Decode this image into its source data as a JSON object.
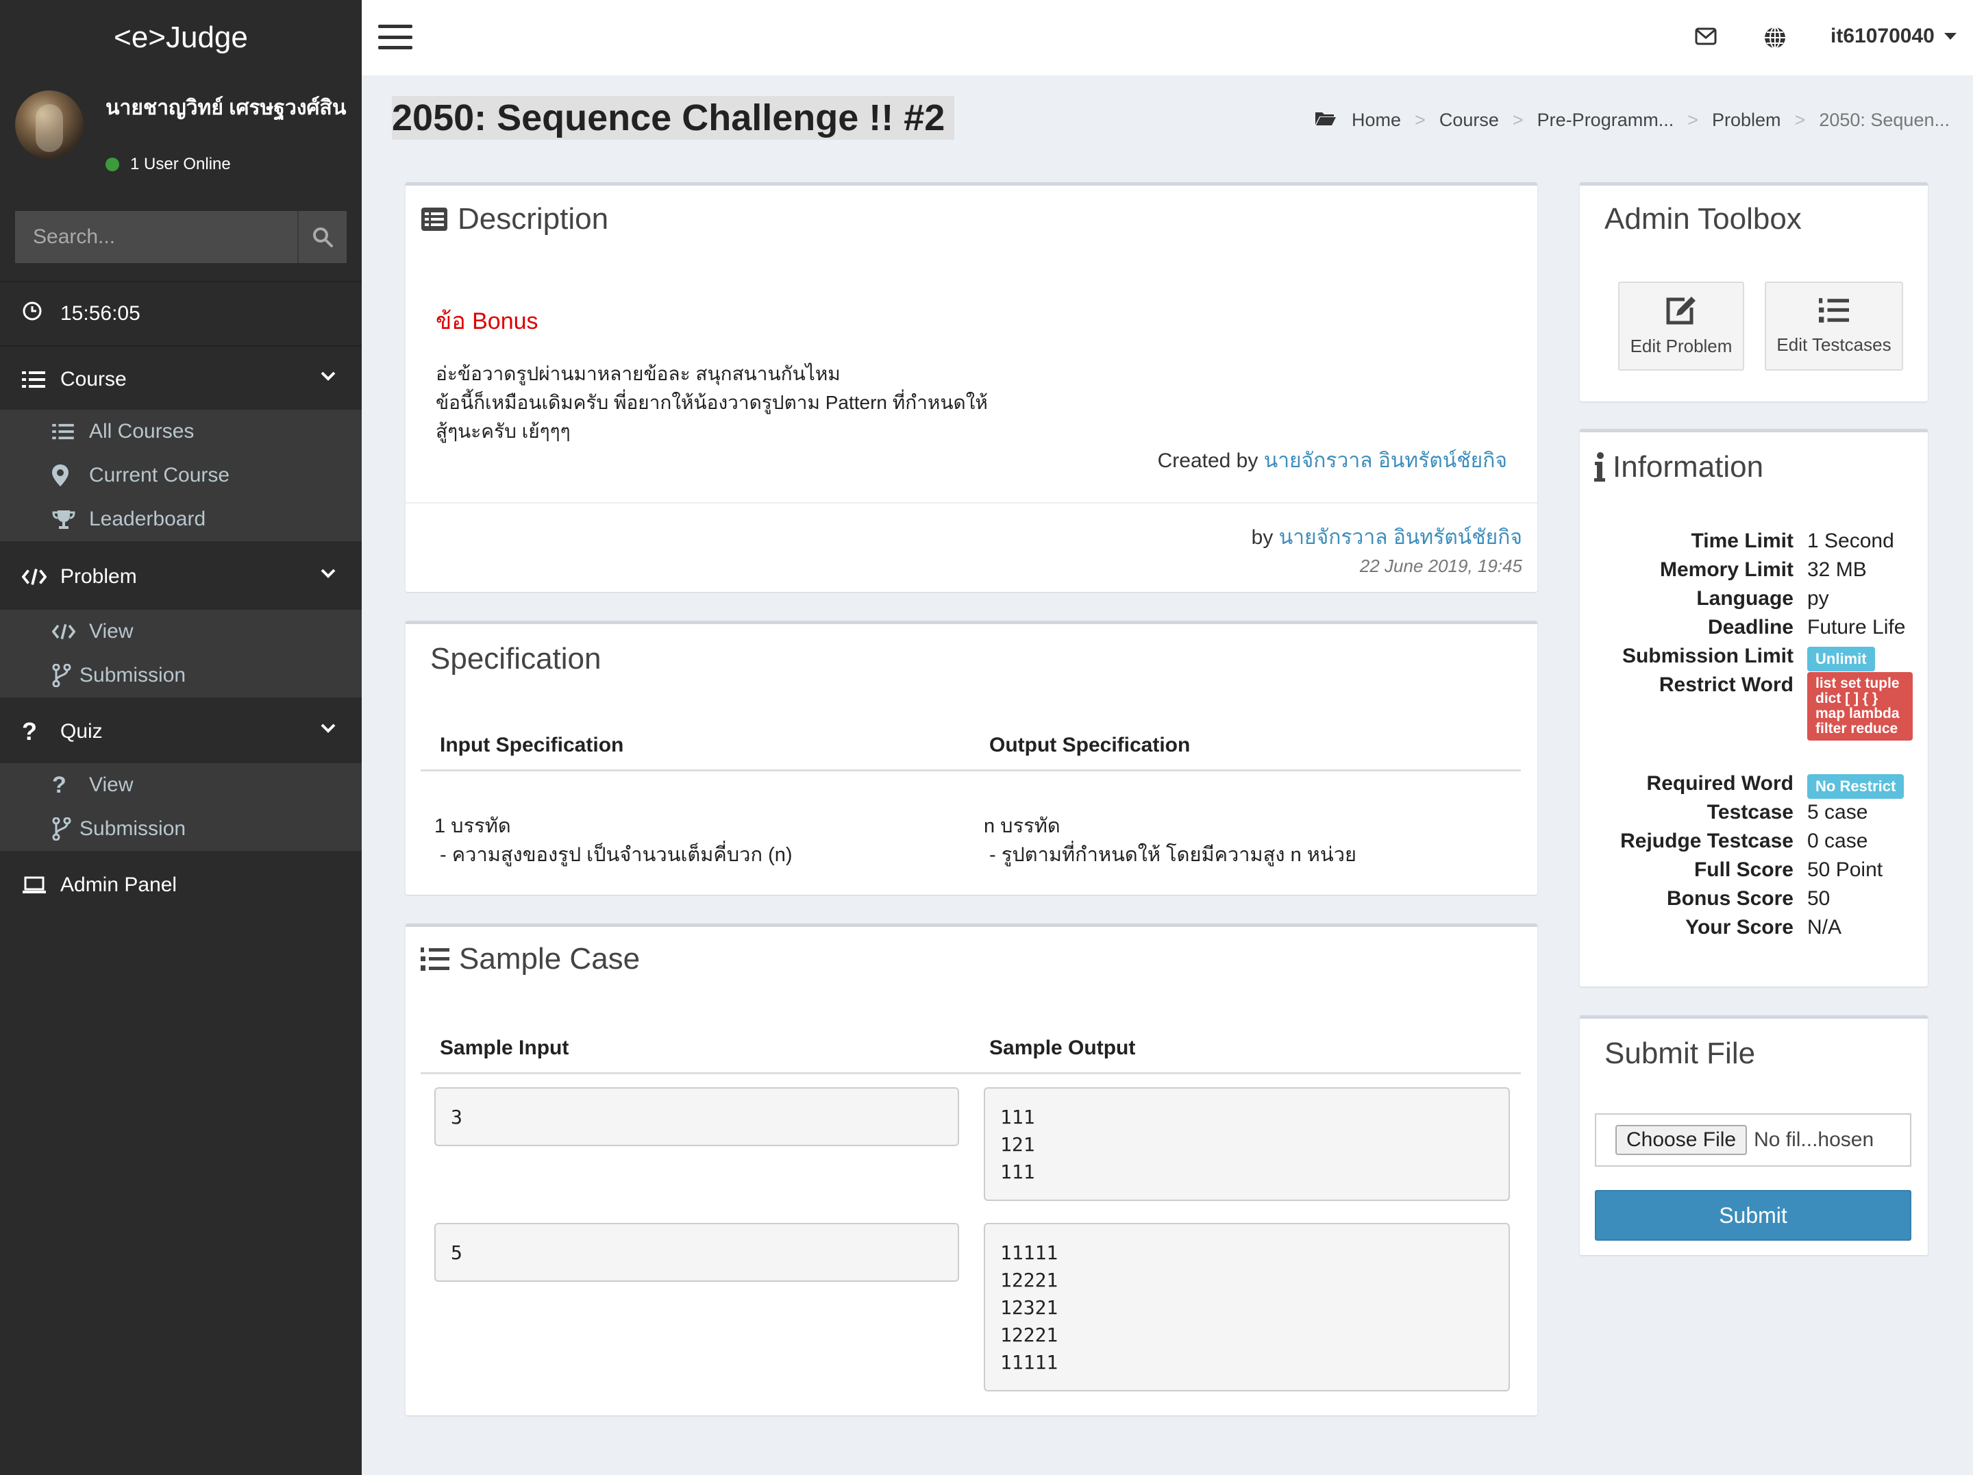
{
  "app": {
    "logo": "<e>Judge"
  },
  "user": {
    "name": "นายชาญวิทย์ เศรษฐวงศ์สิน",
    "status": "1 User Online"
  },
  "search": {
    "placeholder": "Search..."
  },
  "clock": {
    "time": "15:56:05"
  },
  "sidebar": {
    "course": {
      "label": "Course",
      "items": [
        "All Courses",
        "Current Course",
        "Leaderboard"
      ]
    },
    "problem": {
      "label": "Problem",
      "items": [
        "View",
        "Submission"
      ]
    },
    "quiz": {
      "label": "Quiz",
      "items": [
        "View",
        "Submission"
      ]
    },
    "admin": {
      "label": "Admin Panel"
    }
  },
  "topbar": {
    "username": "it61070040"
  },
  "page": {
    "title": "2050: Sequence Challenge !! #2"
  },
  "breadcrumb": [
    "Home",
    "Course",
    "Pre-Programm...",
    "Problem",
    "2050: Sequen..."
  ],
  "description": {
    "title": "Description",
    "bonus": "ข้อ Bonus",
    "lines": [
      "อ่ะข้อวาดรูปผ่านมาหลายข้อละ สนุกสนานกันไหม",
      "ข้อนี้ก็เหมือนเดิมครับ พี่อยากให้น้องวาดรูปตาม Pattern ที่กำหนดให้",
      "สู้ๆนะครับ เย้ๆๆๆ"
    ],
    "created_prefix": "Created by",
    "author": "นายจักรวาล อินทรัตน์ชัยกิจ",
    "by_prefix": "by",
    "by_author": "นายจักรวาล อินทรัตน์ชัยกิจ",
    "date": "22 June 2019, 19:45"
  },
  "specification": {
    "title": "Specification",
    "input_header": "Input Specification",
    "output_header": "Output Specification",
    "input_text": "1 บรรทัด\n - ความสูงของรูป เป็นจำนวนเต็มคี่บวก (n)",
    "output_text": "n บรรทัด\n - รูปตามที่กำหนดให้ โดยมีความสูง n หน่วย"
  },
  "samples": {
    "title": "Sample Case",
    "input_header": "Sample Input",
    "output_header": "Sample Output",
    "cases": [
      {
        "input": "3",
        "output": "111\n121\n111"
      },
      {
        "input": "5",
        "output": "11111\n12221\n12321\n12221\n11111"
      }
    ]
  },
  "admin_toolbox": {
    "title": "Admin Toolbox",
    "edit_problem": "Edit Problem",
    "edit_testcases": "Edit Testcases"
  },
  "information": {
    "title": "Information",
    "rows": {
      "time_limit": {
        "key": "Time Limit",
        "value": "1 Second"
      },
      "memory_limit": {
        "key": "Memory Limit",
        "value": "32 MB"
      },
      "language": {
        "key": "Language",
        "value": "py"
      },
      "deadline": {
        "key": "Deadline",
        "value": "Future Life"
      },
      "submission_limit": {
        "key": "Submission Limit",
        "value": "Unlimit"
      },
      "restrict_word": {
        "key": "Restrict Word",
        "value": "list set tuple dict [ ] { } map lambda filter reduce"
      },
      "required_word": {
        "key": "Required Word",
        "value": "No Restrict"
      },
      "testcase": {
        "key": "Testcase",
        "value": "5 case"
      },
      "rejudge_testcase": {
        "key": "Rejudge Testcase",
        "value": "0 case"
      },
      "full_score": {
        "key": "Full Score",
        "value": "50 Point"
      },
      "bonus_score": {
        "key": "Bonus Score",
        "value": "50"
      },
      "your_score": {
        "key": "Your Score",
        "value": "N/A"
      }
    }
  },
  "submit": {
    "title": "Submit File",
    "choose": "Choose File",
    "no_file": "No fil...hosen",
    "button": "Submit"
  },
  "colors": {
    "sidebar": "#2b2b2b",
    "accent": "#3c8dbc",
    "danger": "#d9534f",
    "info": "#5bc0de",
    "bonus": "#dd0000"
  }
}
